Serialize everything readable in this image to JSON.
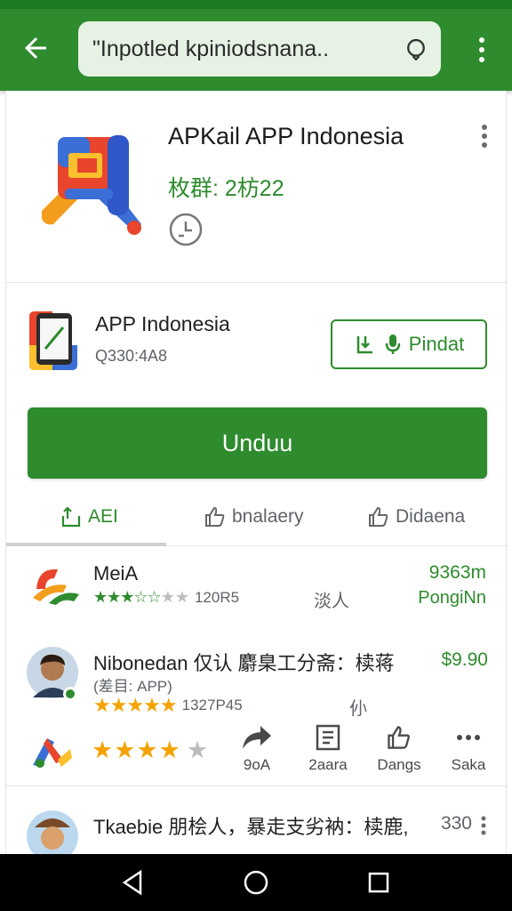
{
  "app_bar": {
    "search_text": "\"Inpotled kpiniodsnana..",
    "icons": {
      "back": "arrow-left-icon",
      "search": "search-icon",
      "menu": "more-vert-icon"
    }
  },
  "hero": {
    "title": "APKail APP Indonesia",
    "subtitle": "枚群: 2枋22",
    "icons": {
      "app": "app-logo-icon",
      "clock": "clock-icon",
      "menu": "more-vert-icon"
    }
  },
  "promo": {
    "title": "APP Indonesia",
    "subtitle": "Q330:4A8",
    "button_label": "Pindat"
  },
  "download_button": {
    "label": "Unduu"
  },
  "tabs": [
    {
      "label": "AEI",
      "icon": "share-icon",
      "active": true
    },
    {
      "label": "bnalaery",
      "icon": "thumb-up-icon",
      "active": false
    },
    {
      "label": "Didaena",
      "icon": "thumb-up-icon",
      "active": false
    }
  ],
  "list": [
    {
      "name": "MeiA",
      "rating_text": "120R5",
      "middle": "淡人",
      "price": "9363m",
      "price_sub": "PongiNn",
      "stars": "★★★☆☆",
      "stars_rest": "★★"
    },
    {
      "name": "Nibonedan 仅认 麝臬工分斋：椟蒋",
      "category": "(差目: APP)",
      "rating_text": "1327P45",
      "middle": "仦",
      "price": "$9.90",
      "stars": "★★★★★",
      "big_stars": "★★★★",
      "big_stars_rest": "★",
      "actions": [
        {
          "label": "9oA",
          "icon": "share-arrow-icon"
        },
        {
          "label": "2aara",
          "icon": "document-icon"
        },
        {
          "label": "Dangs",
          "icon": "thumb-up-icon"
        },
        {
          "label": "Saka",
          "icon": "more-horiz-icon"
        }
      ]
    },
    {
      "name": "Tkaebie 朋桧人，暴走支劣衲：椟鹿,",
      "price": "330"
    }
  ],
  "colors": {
    "primary": "#2e8b2e",
    "primary_dark": "#1c7a22",
    "star_gold": "#f4a300"
  }
}
